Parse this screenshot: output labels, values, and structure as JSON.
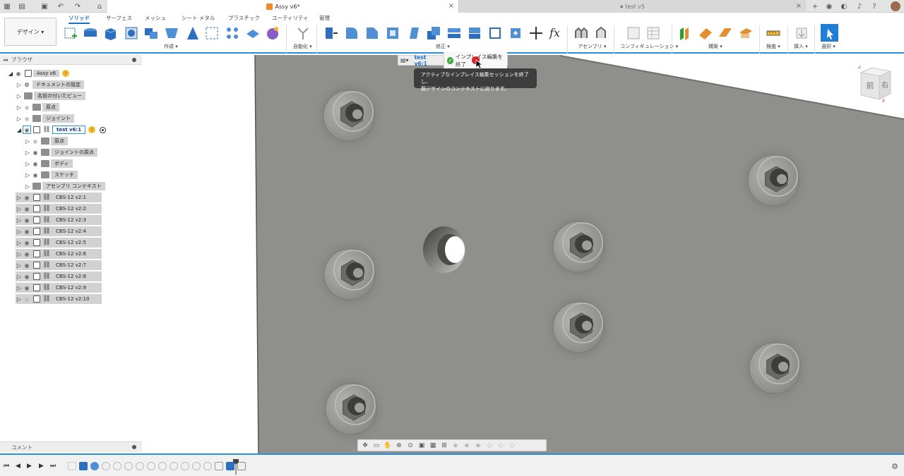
{
  "app": {
    "tabs": [
      {
        "label": "Assy v6*",
        "active": true
      },
      {
        "label": "test v5",
        "active": false
      }
    ]
  },
  "ribbon": {
    "workspace": "デザイン ▾",
    "tabs": [
      "ソリッド",
      "サーフェス",
      "メッシュ",
      "シート メタル",
      "プラスチック",
      "ユーティリティ",
      "管理"
    ],
    "active_tab": "ソリッド",
    "groups": [
      "作成 ▾",
      "自動化 ▾",
      "修正 ▾",
      "アセンブリ ▾",
      "コンフィギュレーション ▾",
      "構築 ▾",
      "検査 ▾",
      "挿入 ▾",
      "選択 ▾"
    ]
  },
  "browser": {
    "title": "ブラウザ",
    "root": "Assy v6",
    "items": [
      {
        "label": "ドキュメントの設定"
      },
      {
        "label": "名前の付いたビュー"
      },
      {
        "label": "原点"
      },
      {
        "label": "ジョイント"
      },
      {
        "label": "test v6:1"
      },
      {
        "label": "原点"
      },
      {
        "label": "ジョイントの原点"
      },
      {
        "label": "ボディ"
      },
      {
        "label": "スケッチ"
      },
      {
        "label": "アセンブリ コンテキスト"
      },
      {
        "label": "CBS-12 v2:1"
      },
      {
        "label": "CBS-12 v2:2"
      },
      {
        "label": "CBS-12 v2:3"
      },
      {
        "label": "CBS-12 v2:4"
      },
      {
        "label": "CBS-12 v2:5"
      },
      {
        "label": "CBS-12 v2:6"
      },
      {
        "label": "CBS-12 v2:7"
      },
      {
        "label": "CBS-12 v2:8"
      },
      {
        "label": "CBS-12 v2:9"
      },
      {
        "label": "CBS-12 v2:10"
      }
    ]
  },
  "comments": {
    "title": "コメント"
  },
  "context_bar": {
    "component": "test v6:1",
    "finish_label": "インプレイス編集を終了"
  },
  "tooltip": {
    "line1": "アクティブなインプレイス編集セッションを終了し、",
    "line2": "親デザインのコンテキストに戻ります。"
  },
  "viewcube": {
    "front": "前",
    "right": "右"
  },
  "colors": {
    "accent": "#2a8fdc",
    "plate": "#8f8f8b",
    "selection": "#1b6fc1"
  }
}
